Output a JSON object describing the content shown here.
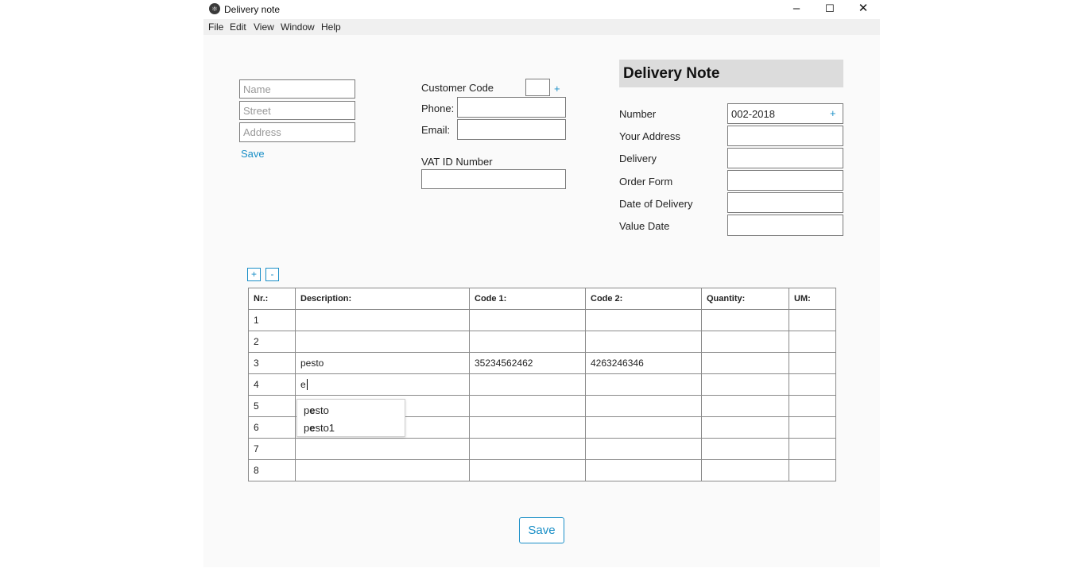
{
  "window": {
    "title": "Delivery note",
    "icon": "app-logo-icon",
    "controls": {
      "minimize": "–",
      "maximize": "☐",
      "close": "✕"
    }
  },
  "menu": [
    "File",
    "Edit",
    "View",
    "Window",
    "Help"
  ],
  "customer": {
    "name_placeholder": "Name",
    "street_placeholder": "Street",
    "address_placeholder": "Address",
    "save_label": "Save"
  },
  "contact": {
    "customer_code_label": "Customer Code",
    "add_symbol": "+",
    "phone_label": "Phone:",
    "email_label": "Email:",
    "vat_label": "VAT ID Number"
  },
  "delivery_note": {
    "title": "Delivery Note",
    "number_label": "Number",
    "number_value": "002-2018",
    "add_symbol": "+",
    "your_address_label": "Your Address",
    "delivery_label": "Delivery",
    "order_form_label": "Order Form",
    "date_of_delivery_label": "Date of Delivery",
    "value_date_label": "Value Date"
  },
  "table_controls": {
    "add": "+",
    "remove": "-"
  },
  "table": {
    "headers": [
      "Nr.:",
      "Description:",
      "Code 1:",
      "Code 2:",
      "Quantity:",
      "UM:"
    ],
    "rows": [
      [
        "1",
        "",
        "",
        "",
        "",
        ""
      ],
      [
        "2",
        "",
        "",
        "",
        "",
        ""
      ],
      [
        "3",
        "pesto",
        "35234562462",
        "4263246346",
        "",
        ""
      ],
      [
        "4",
        "e",
        "",
        "",
        "",
        ""
      ],
      [
        "5",
        "",
        "",
        "",
        "",
        ""
      ],
      [
        "6",
        "",
        "",
        "",
        "",
        ""
      ],
      [
        "7",
        "",
        "",
        "",
        "",
        ""
      ],
      [
        "8",
        "",
        "",
        "",
        "",
        ""
      ]
    ]
  },
  "autocomplete": {
    "items": [
      {
        "pre": "p",
        "match": "e",
        "post": "sto"
      },
      {
        "pre": "p",
        "match": "e",
        "post": "sto1"
      }
    ]
  },
  "footer": {
    "save_label": "Save"
  },
  "colors": {
    "accent": "#1a8fc7",
    "header_bg": "#dcdcdc"
  }
}
